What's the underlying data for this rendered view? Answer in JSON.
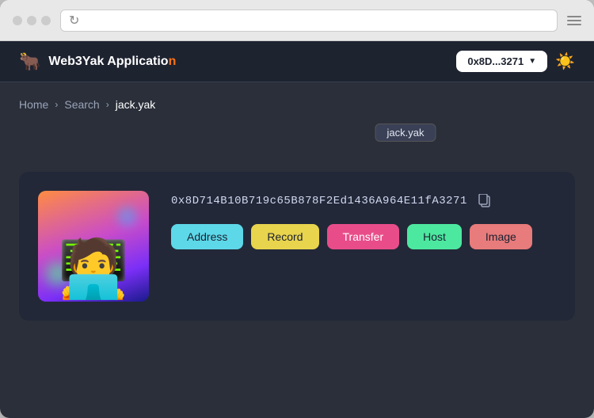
{
  "browser": {
    "url_placeholder": ""
  },
  "app": {
    "logo_text": "Web3Yak Application",
    "logo_accent": "n",
    "wallet_address": "0x8D...3271",
    "theme_icon": "☀️"
  },
  "breadcrumb": {
    "home": "Home",
    "search": "Search",
    "current": "jack.yak"
  },
  "ens_tag": "jack.yak",
  "profile": {
    "address": "0x8D714B10B719c65B878F2Ed1436A964E11fA3271",
    "buttons": [
      {
        "label": "Address",
        "class": "btn-address"
      },
      {
        "label": "Record",
        "class": "btn-record"
      },
      {
        "label": "Transfer",
        "class": "btn-transfer"
      },
      {
        "label": "Host",
        "class": "btn-host"
      },
      {
        "label": "Image",
        "class": "btn-image"
      }
    ]
  }
}
